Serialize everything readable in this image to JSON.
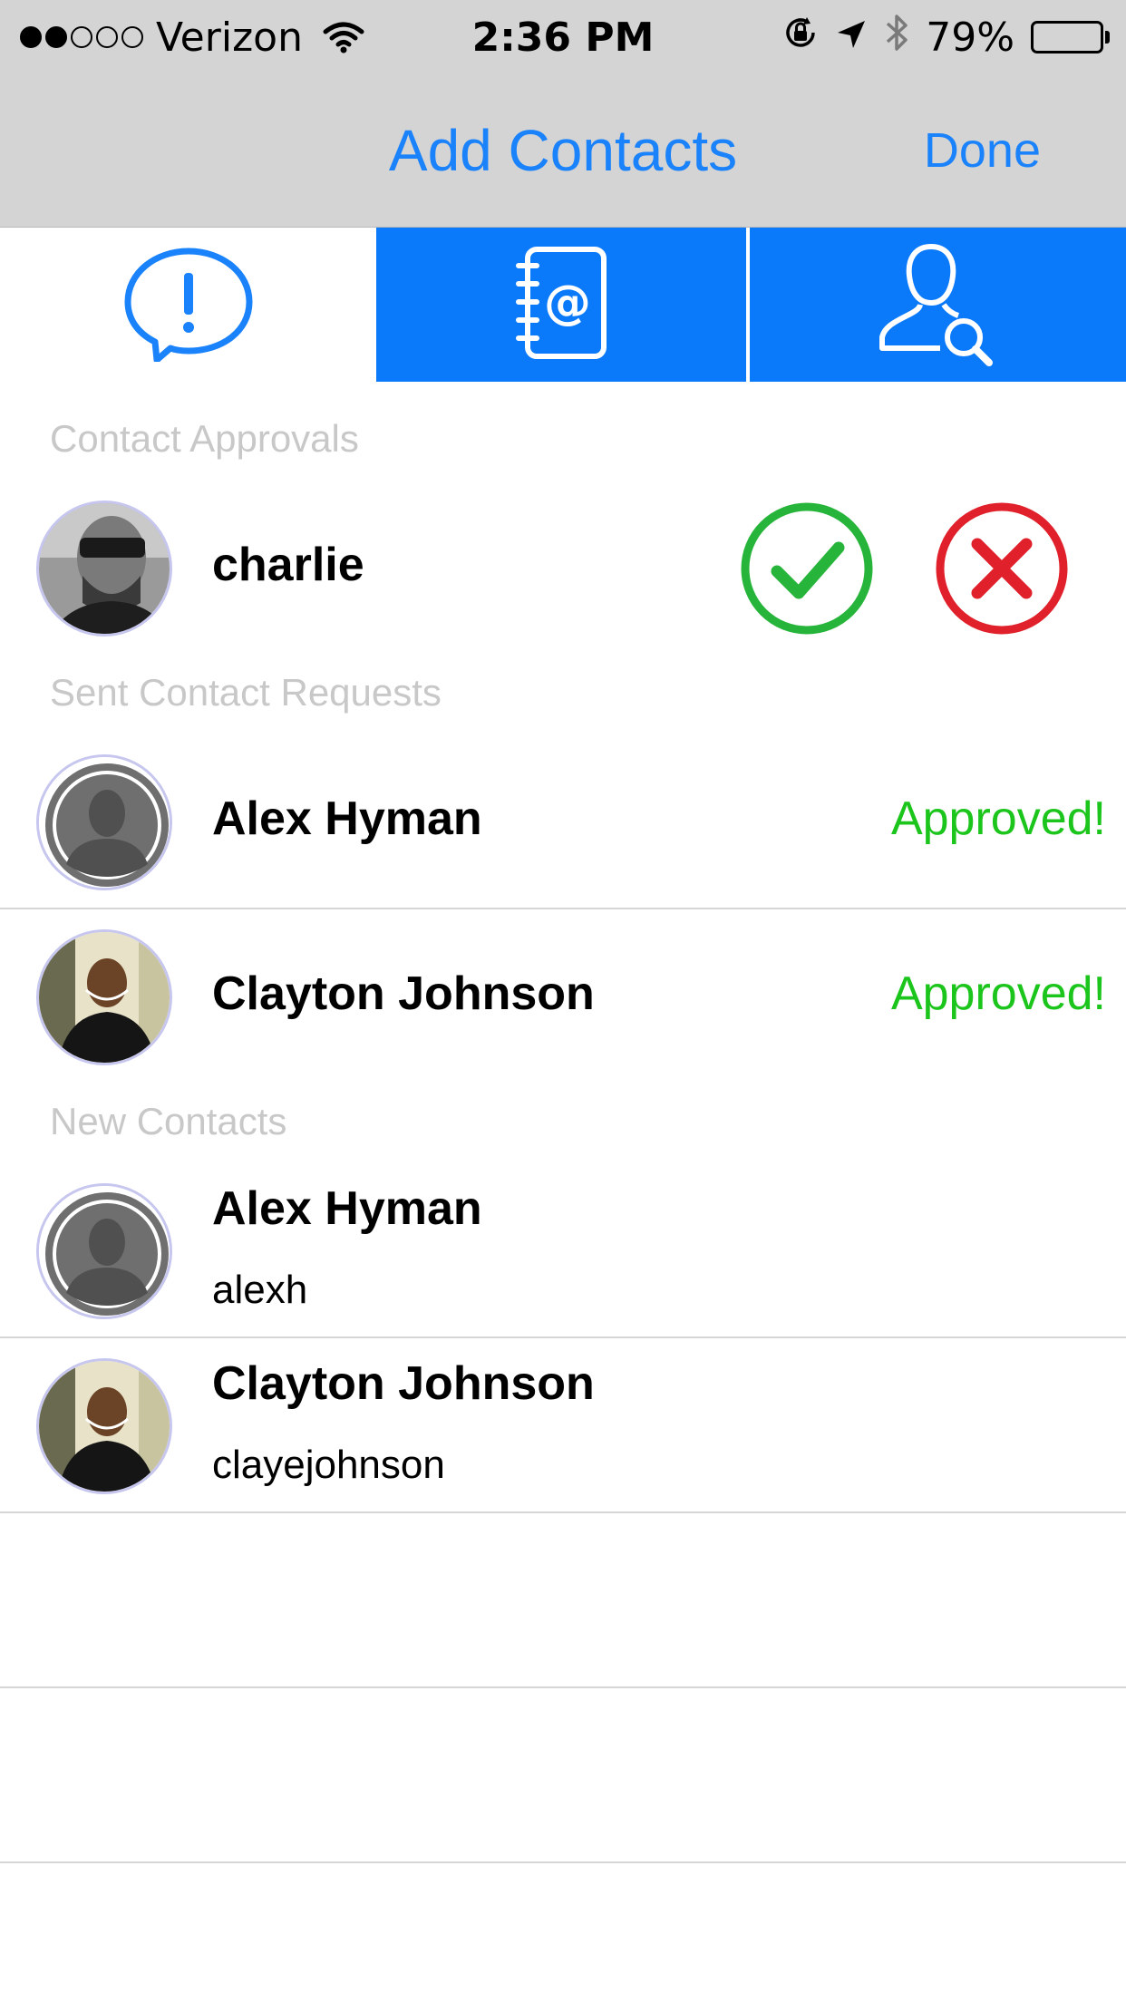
{
  "status_bar": {
    "carrier": "Verizon",
    "time": "2:36 PM",
    "battery": "79%",
    "battery_level": 0.79,
    "signal_bars_filled": 2,
    "signal_bars_total": 5,
    "icons": [
      "wifi-icon",
      "orientation-lock-icon",
      "location-arrow-icon",
      "bluetooth-icon",
      "battery-icon"
    ]
  },
  "nav": {
    "title": "Add Contacts",
    "done_label": "Done"
  },
  "tabs": [
    {
      "icon": "notification-bubble-icon",
      "selected": true
    },
    {
      "icon": "address-book-icon",
      "selected": false
    },
    {
      "icon": "search-user-icon",
      "selected": false
    }
  ],
  "sections": {
    "approvals_header": "Contact Approvals",
    "sent_header": "Sent Contact Requests",
    "new_header": "New Contacts"
  },
  "approvals": [
    {
      "name": "charlie",
      "accept_icon": "checkmark-circle-icon",
      "reject_icon": "x-circle-icon"
    }
  ],
  "sent_requests": [
    {
      "name": "Alex Hyman",
      "status": "Approved!"
    },
    {
      "name": "Clayton Johnson",
      "status": "Approved!"
    }
  ],
  "new_contacts": [
    {
      "name": "Alex Hyman",
      "username": "alexh"
    },
    {
      "name": "Clayton Johnson",
      "username": "clayejohnson"
    }
  ],
  "colors": {
    "accent": "#1a82fb",
    "tab_blue": "#0a7afb",
    "approved_green": "#1cc51c",
    "accept_green": "#27b43a",
    "reject_red": "#e0202a",
    "section_header": "#c8c8c8",
    "bar_gray": "#d4d4d4"
  }
}
